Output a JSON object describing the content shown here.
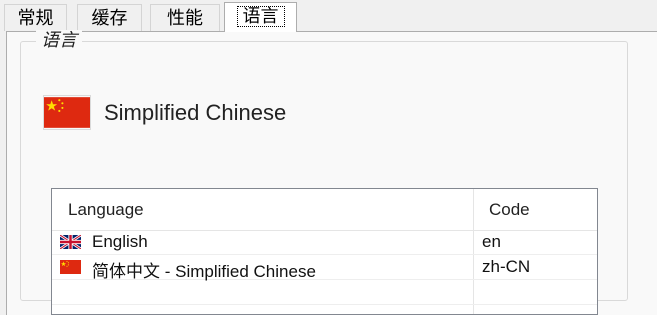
{
  "tabs": [
    {
      "label": "常规"
    },
    {
      "label": "缓存"
    },
    {
      "label": "性能"
    },
    {
      "label": "语言",
      "active": true
    }
  ],
  "language_group": {
    "title": "语言",
    "current": {
      "name": "Simplified Chinese",
      "flag_icon": "china-flag-icon"
    }
  },
  "language_list": {
    "columns": [
      "Language",
      "Code"
    ],
    "rows": [
      {
        "name": "English",
        "code": "en",
        "flag_icon": "uk-flag-icon"
      },
      {
        "name": "简体中文 - Simplified Chinese",
        "code": "zh-CN",
        "flag_icon": "china-flag-icon"
      }
    ]
  },
  "colors": {
    "flag_red": "#de2910",
    "flag_yellow": "#ffde00",
    "uk_blue": "#012169",
    "uk_red": "#c8102e",
    "panel_bg": "#f9f9f9",
    "window_bg": "#f0f0f0"
  }
}
